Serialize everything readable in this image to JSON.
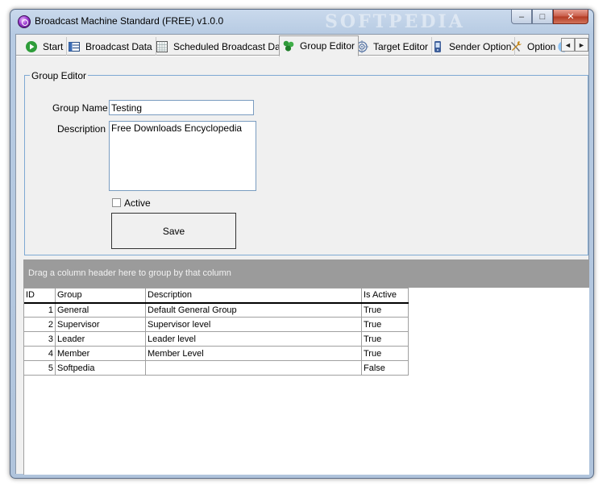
{
  "window": {
    "title": "Broadcast Machine Standard (FREE) v1.0.0",
    "watermark": "SOFTPEDIA",
    "controls": {
      "minimize": "‒",
      "maximize": "□",
      "close": "✕"
    }
  },
  "tabs": [
    {
      "label": "Start",
      "icon": "play-icon",
      "active": false
    },
    {
      "label": "Broadcast Data",
      "icon": "data-icon",
      "active": false
    },
    {
      "label": "Scheduled Broadcast Data",
      "icon": "calendar-icon",
      "active": false
    },
    {
      "label": "Group Editor",
      "icon": "group-icon",
      "active": true
    },
    {
      "label": "Target Editor",
      "icon": "target-icon",
      "active": false
    },
    {
      "label": "Sender Option",
      "icon": "phone-icon",
      "active": false
    },
    {
      "label": "Option",
      "icon": "tools-icon",
      "active": false
    }
  ],
  "tab_scroll": {
    "left": "◄",
    "right": "►"
  },
  "group_editor": {
    "legend": "Group Editor",
    "group_name_label": "Group Name :",
    "group_name_value": "Testing",
    "description_label": "Description :",
    "description_value": "Free Downloads Encyclopedia",
    "active_label": "Active",
    "active_checked": false,
    "save_label": "Save"
  },
  "grid": {
    "group_panel_text": "Drag a column header here to group by that column",
    "columns": [
      "ID",
      "Group",
      "Description",
      "Is Active"
    ],
    "rows": [
      {
        "id": "1",
        "group": "General",
        "description": "Default General Group",
        "is_active": "True"
      },
      {
        "id": "2",
        "group": "Supervisor",
        "description": "Supervisor level",
        "is_active": "True"
      },
      {
        "id": "3",
        "group": "Leader",
        "description": "Leader level",
        "is_active": "True"
      },
      {
        "id": "4",
        "group": "Member",
        "description": "Member Level",
        "is_active": "True"
      },
      {
        "id": "5",
        "group": "Softpedia",
        "description": "",
        "is_active": "False"
      }
    ]
  },
  "colors": {
    "frame": "#b7cbe3",
    "group_border": "#7ea9d3",
    "group_panel": "#9b9b9b",
    "close_button": "#c75a45"
  }
}
